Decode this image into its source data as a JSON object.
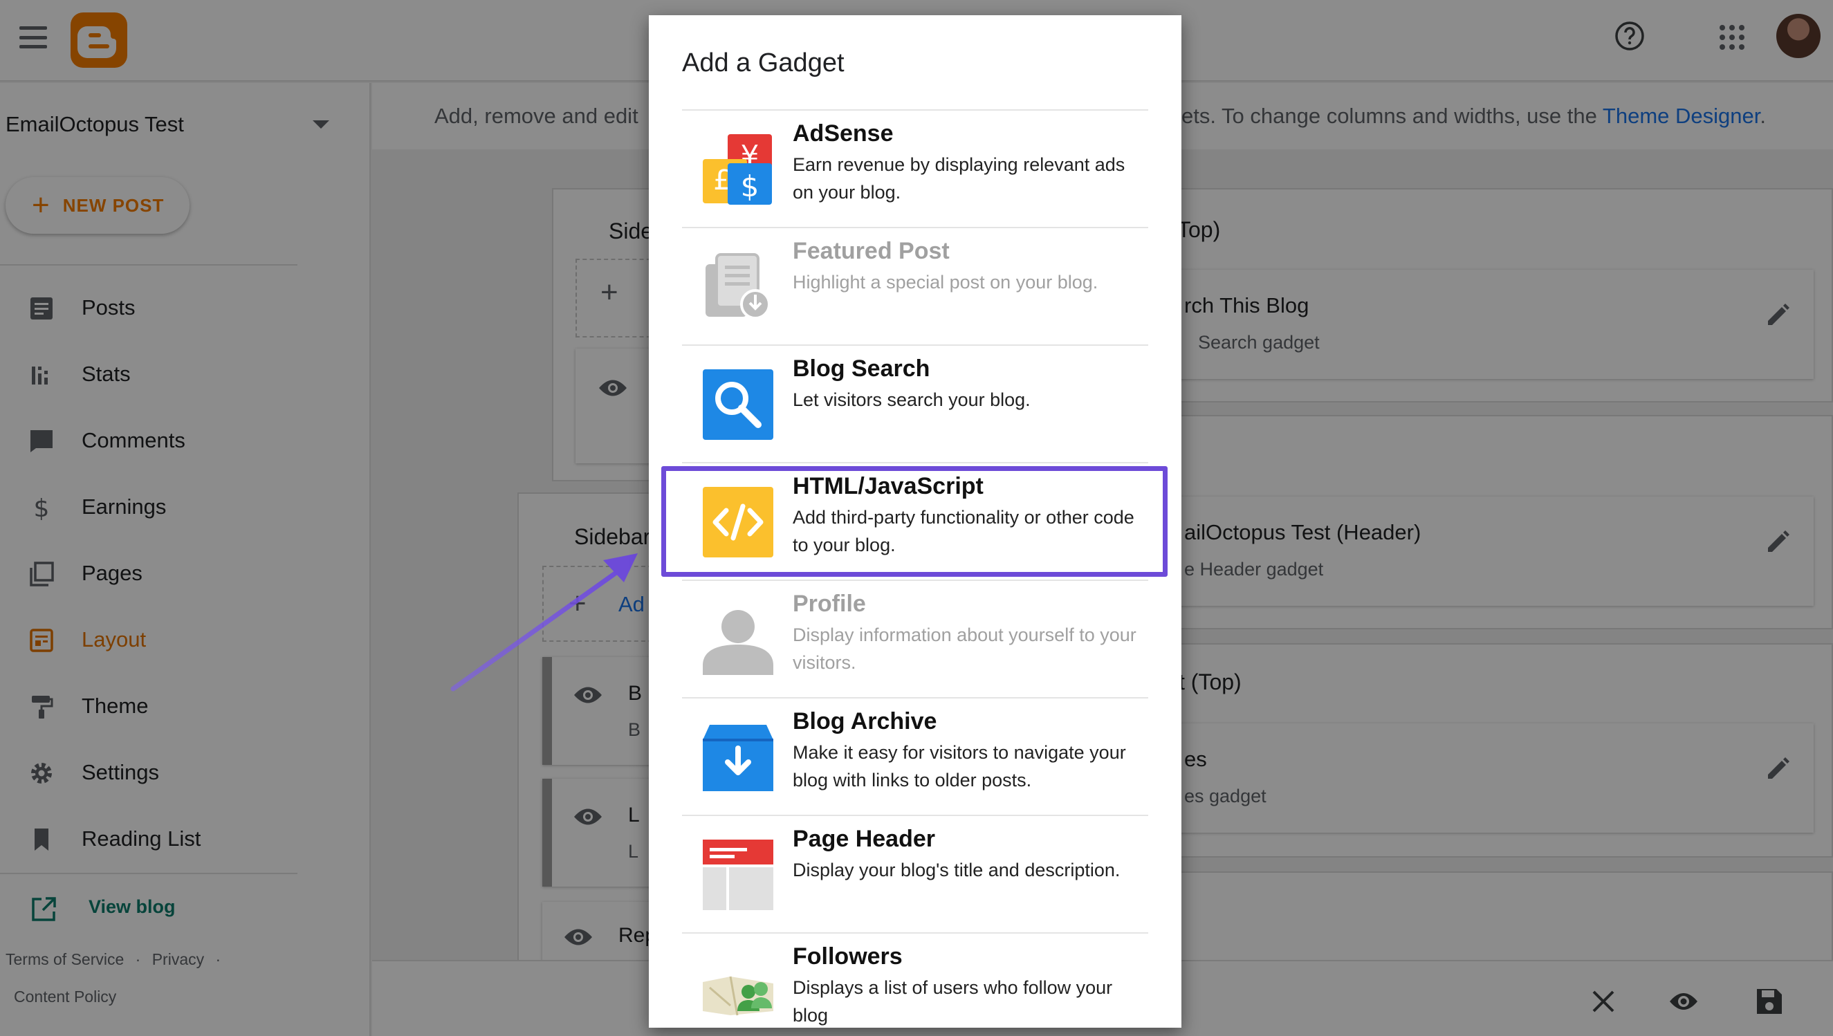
{
  "sidebar": {
    "blog_name": "EmailOctopus Test",
    "new_post_label": "NEW POST",
    "items": [
      {
        "label": "Posts",
        "icon": "posts-icon"
      },
      {
        "label": "Stats",
        "icon": "stats-icon"
      },
      {
        "label": "Comments",
        "icon": "comments-icon"
      },
      {
        "label": "Earnings",
        "icon": "dollar-icon"
      },
      {
        "label": "Pages",
        "icon": "pages-icon"
      },
      {
        "label": "Layout",
        "icon": "layout-icon",
        "active": true
      },
      {
        "label": "Theme",
        "icon": "paint-roller-icon"
      },
      {
        "label": "Settings",
        "icon": "gear-icon"
      },
      {
        "label": "Reading List",
        "icon": "bookmark-icon"
      }
    ],
    "view_blog": "View blog",
    "footer": {
      "terms": "Terms of Service",
      "sep": "·",
      "privacy": "Privacy",
      "sep2": "·",
      "content_policy": "Content Policy"
    }
  },
  "main": {
    "info_left": "Add, remove and edit",
    "info_right_prefix": "ets. To change columns and widths, use the",
    "info_link": "Theme Designer",
    "info_end": ".",
    "panels": {
      "sidebar_top_title": "Side",
      "sidebar_bottom_title": "Sidebar",
      "add_partial": "Ad",
      "top_right_title": "Top)",
      "search_gadget_title": "rch This Blog",
      "search_gadget_sub": "Search gadget",
      "header_gadget_title": "ailOctopus Test (Header)",
      "header_gadget_sub": "e Header gadget",
      "third_title": "t (Top)",
      "pages_gadget_title": "es",
      "pages_gadget_sub": "es gadget",
      "left_card1_title": "B",
      "left_card1_sub": "B",
      "left_card2_title": "L",
      "left_card2_sub": "L",
      "left_card3_title": "Rep"
    }
  },
  "dialog": {
    "title": "Add a Gadget",
    "gadgets": [
      {
        "name": "AdSense",
        "desc": "Earn revenue by displaying relevant ads on your blog.",
        "icon": "adsense-icon",
        "enabled": true
      },
      {
        "name": "Featured Post",
        "desc": "Highlight a special post on your blog.",
        "icon": "featured-post-icon",
        "enabled": false
      },
      {
        "name": "Blog Search",
        "desc": "Let visitors search your blog.",
        "icon": "blog-search-icon",
        "enabled": true
      },
      {
        "name": "HTML/JavaScript",
        "desc": "Add third-party functionality or other code to your blog.",
        "icon": "code-icon",
        "enabled": true,
        "highlighted": true
      },
      {
        "name": "Profile",
        "desc": "Display information about yourself to your visitors.",
        "icon": "profile-icon",
        "enabled": false
      },
      {
        "name": "Blog Archive",
        "desc": "Make it easy for visitors to navigate your blog with links to older posts.",
        "icon": "archive-icon",
        "enabled": true
      },
      {
        "name": "Page Header",
        "desc": "Display your blog's title and description.",
        "icon": "page-header-icon",
        "enabled": true
      },
      {
        "name": "Followers",
        "desc": "Displays a list of users who follow your blog",
        "icon": "followers-icon",
        "enabled": true
      }
    ]
  },
  "colors": {
    "accent": "#f57d00",
    "highlight": "#6d4bd8",
    "link": "#1a73e8",
    "view_blog": "#0d7d6c"
  }
}
